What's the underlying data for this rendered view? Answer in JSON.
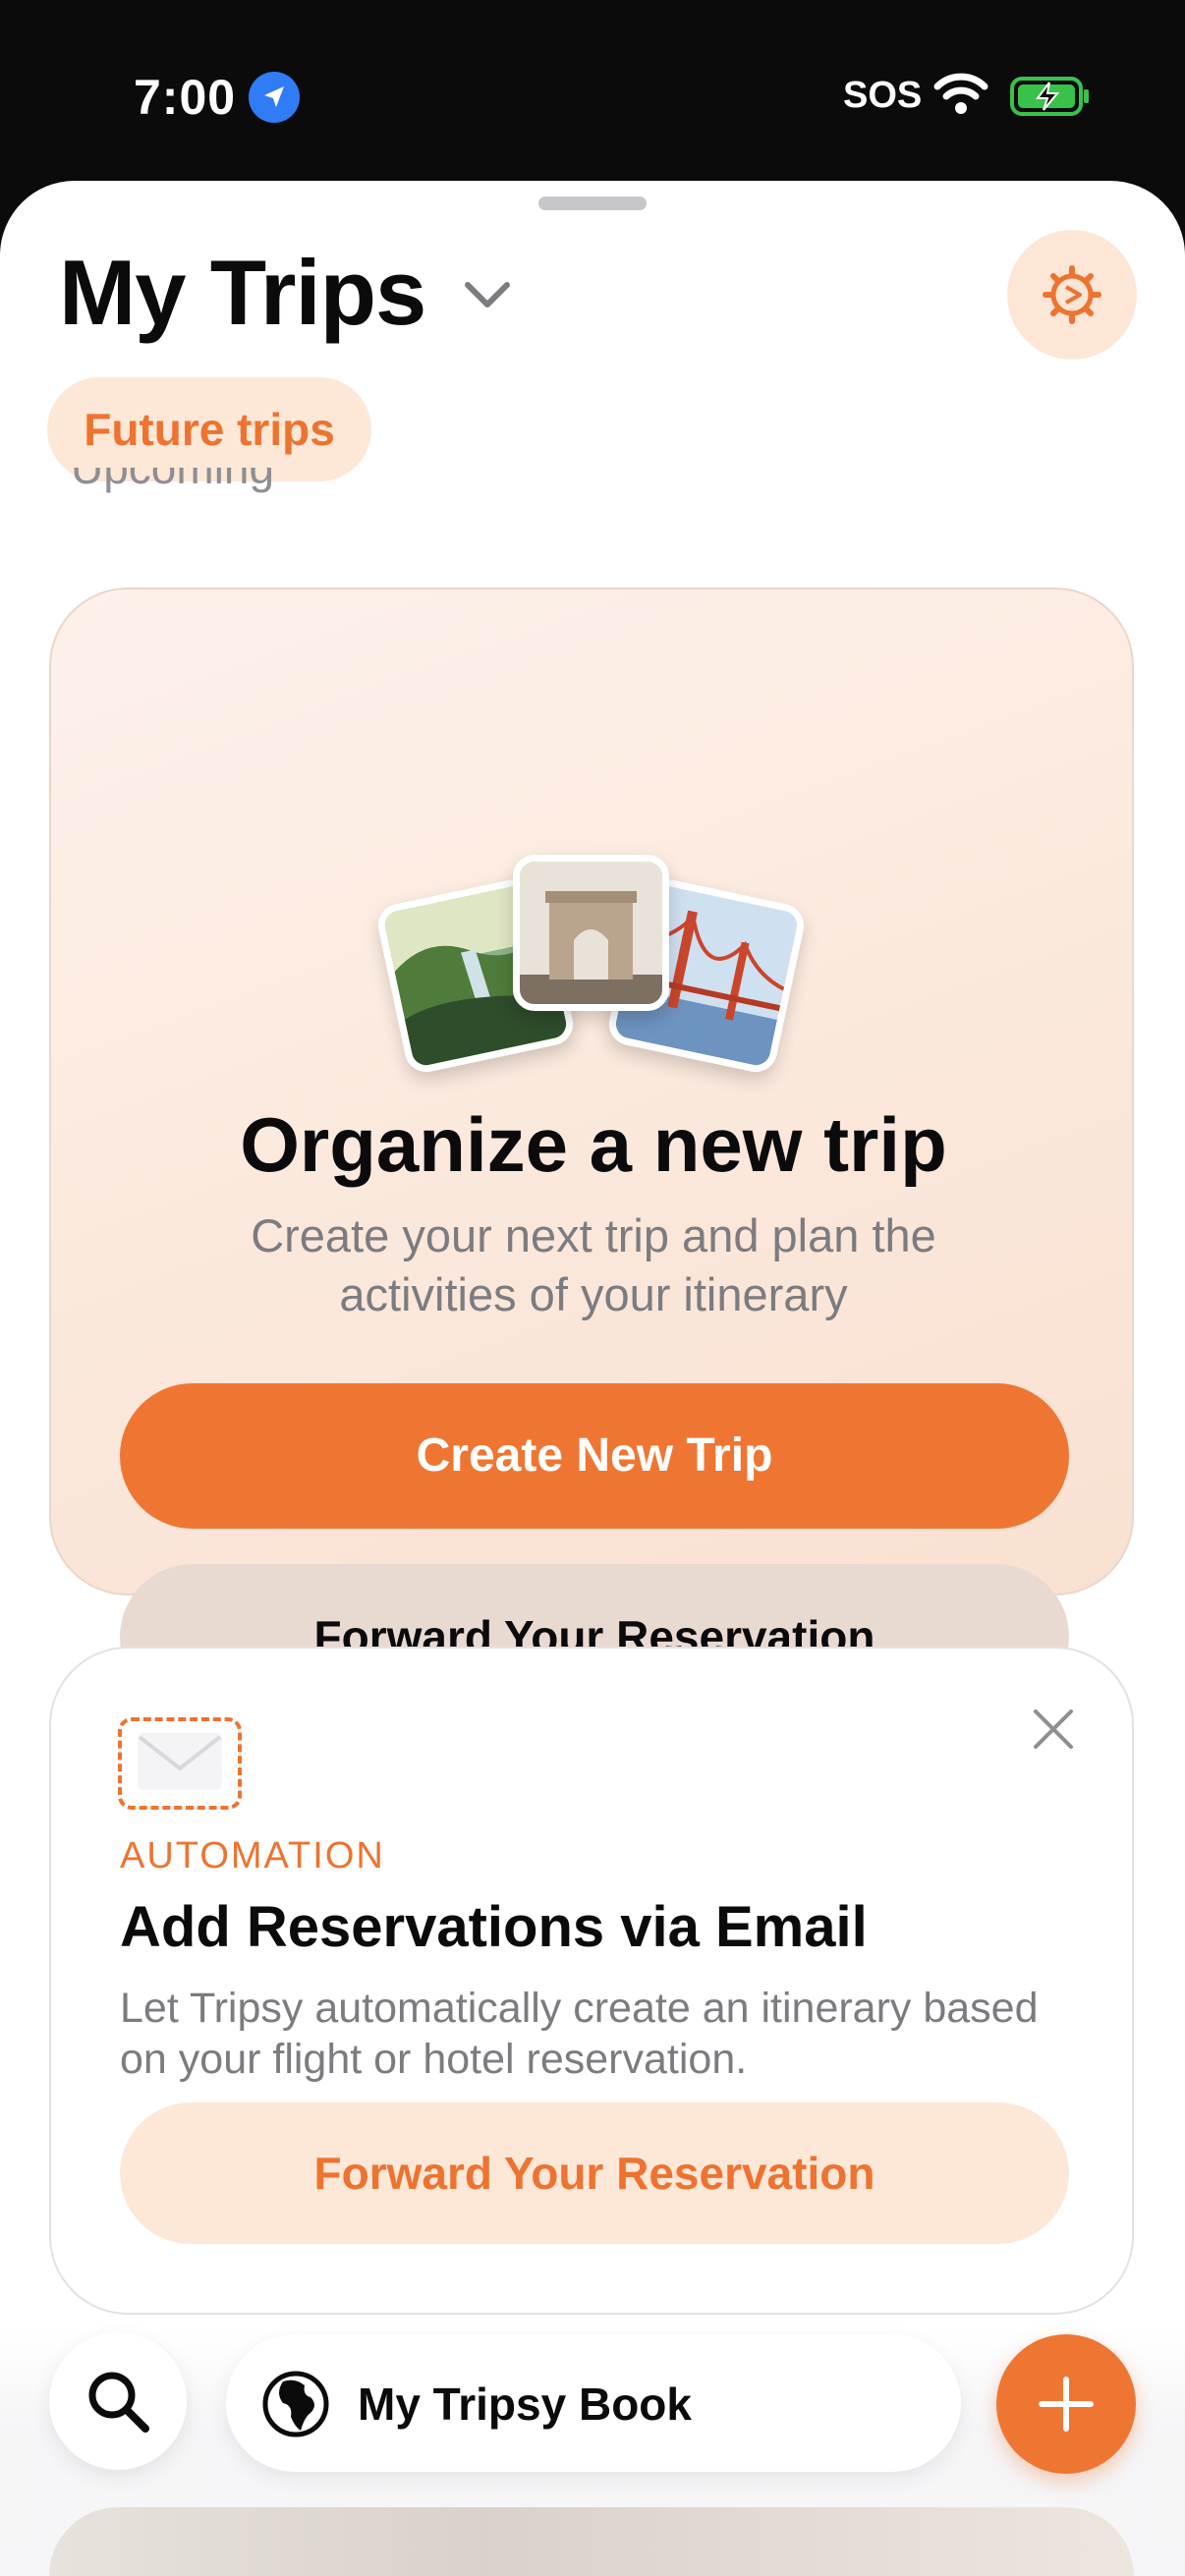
{
  "status_bar": {
    "time": "7:00",
    "carrier": "SOS"
  },
  "header": {
    "title": "My Trips",
    "filter_chip": "Future trips",
    "section_label": "Upcoming"
  },
  "promo": {
    "title": "Organize a new trip",
    "subtitle": "Create your next trip and plan the activities of your itinerary",
    "primary_button": "Create New Trip",
    "secondary_button": "Forward Your Reservation"
  },
  "automation": {
    "eyebrow": "AUTOMATION",
    "title": "Add Reservations via Email",
    "description": "Let Tripsy automatically create an itinerary based on your flight or hotel reservation.",
    "button": "Forward Your Reservation"
  },
  "bottom_bar": {
    "book_label": "My Tripsy Book"
  },
  "colors": {
    "accent": "#ef7632",
    "accent_soft": "#fde8d8",
    "card_bg": "#fbe8dc"
  },
  "icons": [
    "location-icon",
    "wifi-icon",
    "battery-icon",
    "chevron-down-icon",
    "gear-icon",
    "mail-icon",
    "close-icon",
    "search-icon",
    "globe-icon",
    "plus-icon"
  ]
}
